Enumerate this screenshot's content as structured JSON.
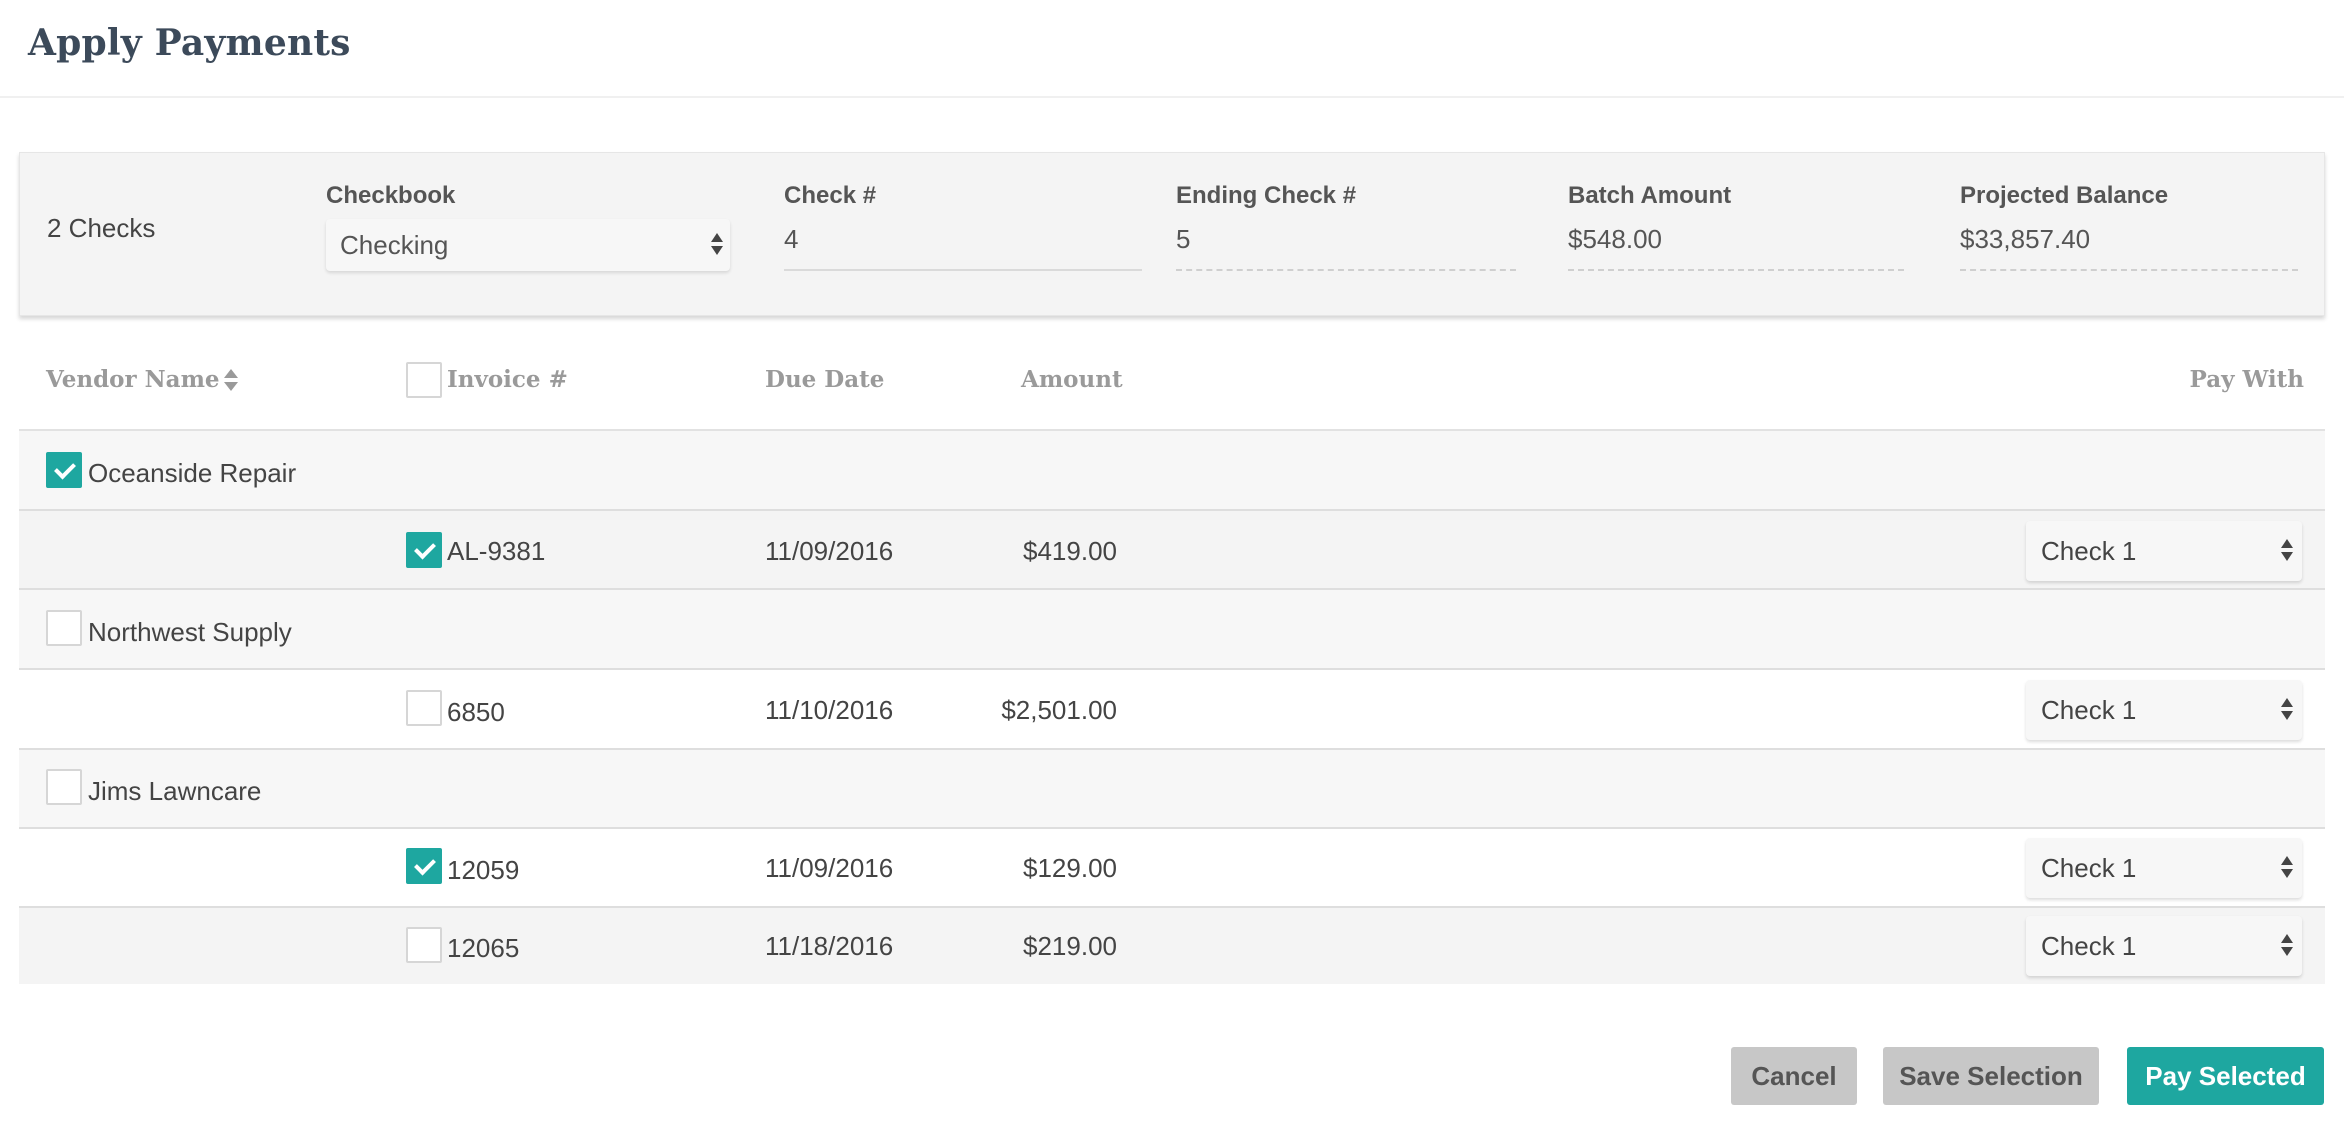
{
  "header": {
    "title": "Apply Payments"
  },
  "summary": {
    "checks_count": "2 Checks",
    "checkbook": {
      "label": "Checkbook",
      "value": "Checking"
    },
    "check_number": {
      "label": "Check #",
      "value": "4"
    },
    "ending_check": {
      "label": "Ending Check #",
      "value": "5"
    },
    "batch_amount": {
      "label": "Batch Amount",
      "value": "$548.00"
    },
    "projected_balance": {
      "label": "Projected Balance",
      "value": "$33,857.40"
    }
  },
  "table": {
    "columns": {
      "vendor": "Vendor Name",
      "invoice": "Invoice #",
      "due_date": "Due Date",
      "amount": "Amount",
      "pay_with": "Pay With"
    },
    "select_all_checked": false,
    "vendors": [
      {
        "name": "Oceanside Repair",
        "checked": true,
        "invoices": [
          {
            "number": "AL-9381",
            "due": "11/09/2016",
            "amount": "$419.00",
            "pay_with": "Check 1",
            "checked": true
          }
        ]
      },
      {
        "name": "Northwest Supply",
        "checked": false,
        "invoices": [
          {
            "number": "6850",
            "due": "11/10/2016",
            "amount": "$2,501.00",
            "pay_with": "Check 1",
            "checked": false
          }
        ]
      },
      {
        "name": "Jims Lawncare",
        "checked": false,
        "invoices": [
          {
            "number": "12059",
            "due": "11/09/2016",
            "amount": "$129.00",
            "pay_with": "Check 1",
            "checked": true
          },
          {
            "number": "12065",
            "due": "11/18/2016",
            "amount": "$219.00",
            "pay_with": "Check 1",
            "checked": false
          }
        ]
      }
    ]
  },
  "footer": {
    "cancel_label": "Cancel",
    "save_label": "Save Selection",
    "pay_label": "Pay Selected"
  },
  "colors": {
    "accent": "#1ea7a0",
    "title": "#3c4a5a",
    "neutral_button": "#c7c7c7"
  }
}
